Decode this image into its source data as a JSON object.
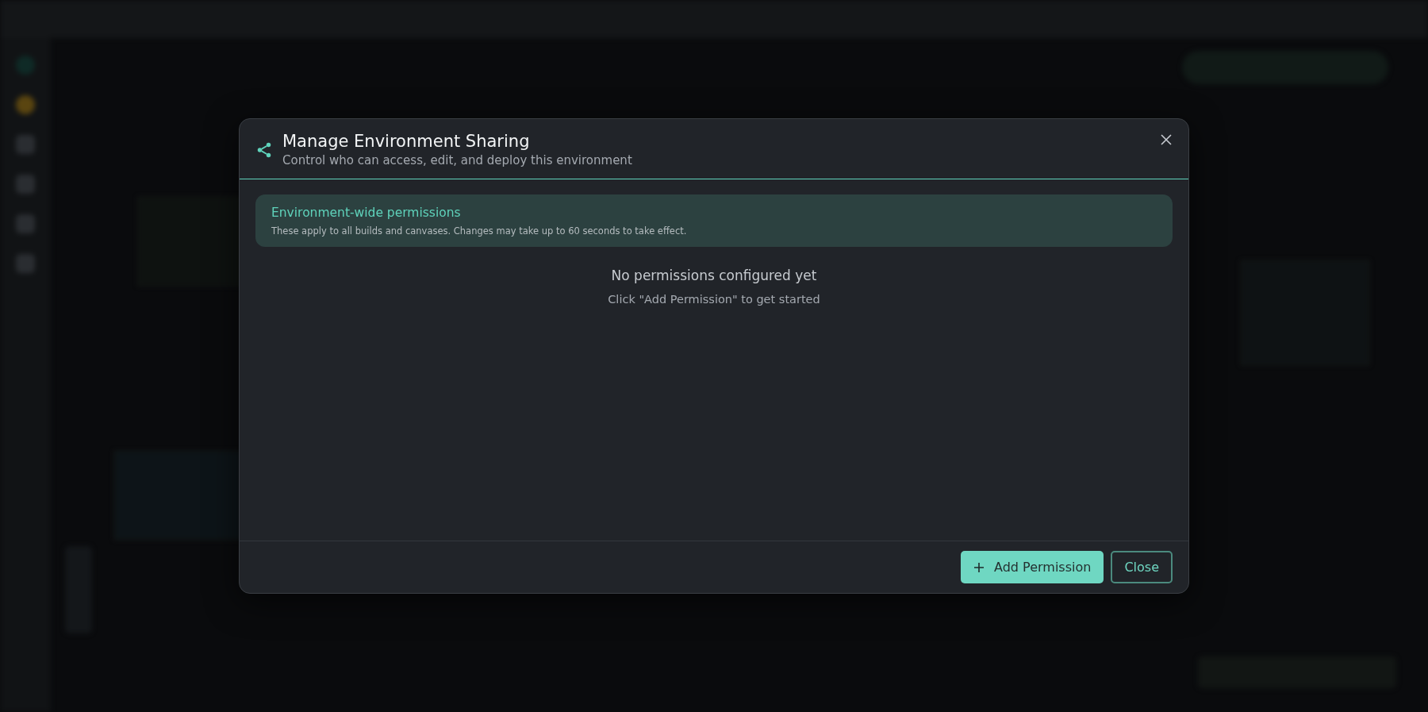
{
  "dialog": {
    "title": "Manage Environment Sharing",
    "subtitle": "Control who can access, edit, and deploy this environment",
    "notice": {
      "title": "Environment-wide permissions",
      "text": "These apply to all builds and canvases. Changes may take up to 60 seconds to take effect."
    },
    "empty_state": {
      "title": "No permissions configured yet",
      "hint": "Click \"Add Permission\" to get started"
    },
    "buttons": [
      {
        "label": "Add Permission",
        "kind": "primary"
      },
      {
        "label": "Close",
        "kind": "secondary"
      }
    ]
  }
}
